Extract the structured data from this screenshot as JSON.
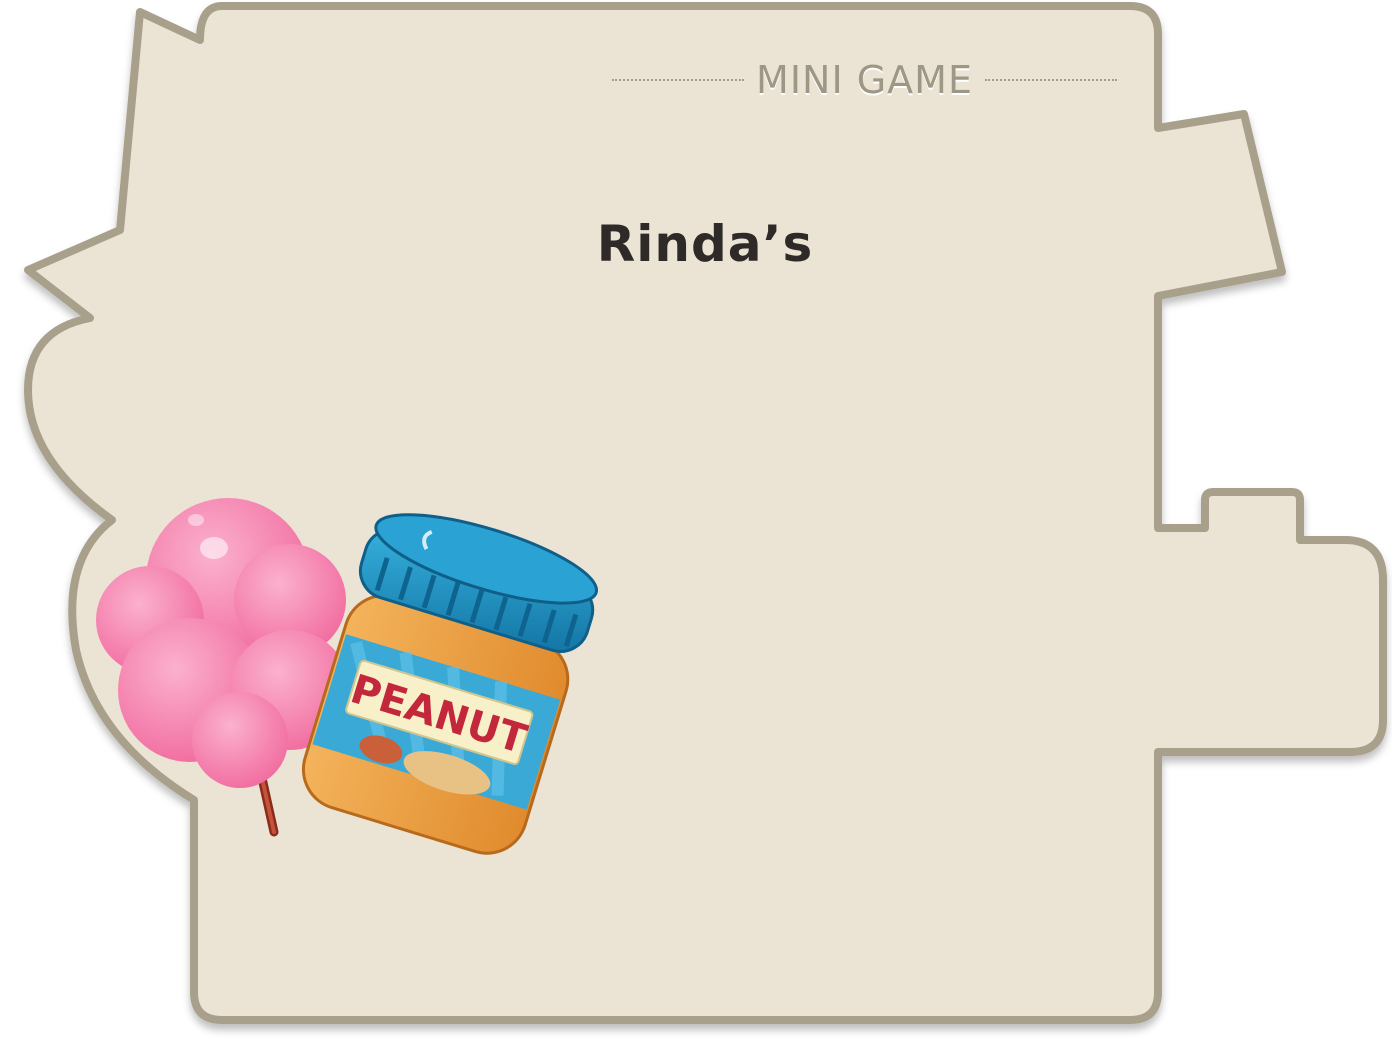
{
  "minigame_card": {
    "header_label": "MINI GAME",
    "title": "Rinda’s",
    "colors": {
      "card_fill": "#ebe4d5",
      "card_border": "#a8a08b",
      "title_text": "#2e2a27",
      "header_text": "#9d9786"
    }
  },
  "illustrations": {
    "cotton_candy": {
      "icon": "cotton-candy-icon",
      "color": "#f58bb4"
    },
    "peanut_jar": {
      "icon": "peanut-butter-jar-icon",
      "label": "PEANUT",
      "lid_color": "#1e8fbf",
      "jar_color": "#f0a64a"
    }
  }
}
